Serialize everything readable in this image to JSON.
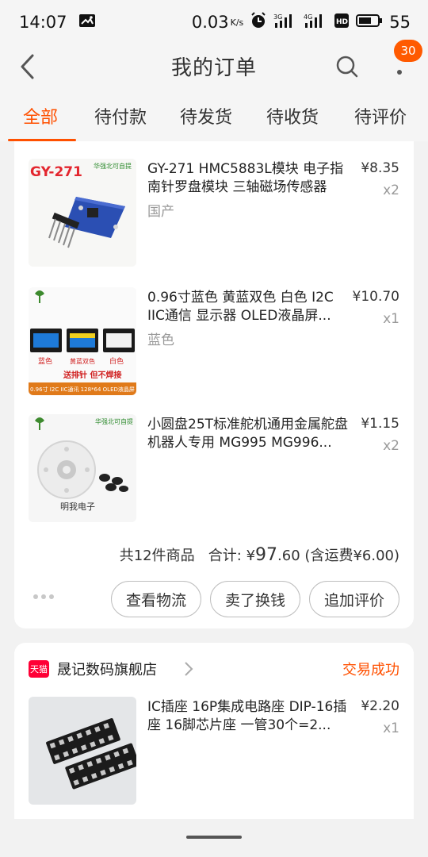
{
  "status_bar": {
    "time": "14:07",
    "net_speed": "0.03",
    "net_unit": "K/s",
    "signal_3g": "3G",
    "signal_4g": "4G",
    "hd": "HD",
    "battery": "55"
  },
  "header": {
    "title": "我的订单",
    "badge_count": "30"
  },
  "tabs": [
    {
      "label": "全部",
      "active": true
    },
    {
      "label": "待付款"
    },
    {
      "label": "待发货"
    },
    {
      "label": "待收货"
    },
    {
      "label": "待评价"
    }
  ],
  "order1": {
    "items": [
      {
        "title": "GY-271 HMC5883L模块 电子指南针罗盘模块 三轴磁场传感器",
        "spec": "国产",
        "price": "¥8.35",
        "qty": "x2",
        "thumb_text": "GY-271",
        "thumb_brand": "华强北可自提"
      },
      {
        "title": "0.96寸蓝色 黄蓝双色 白色 I2C IIC通信 显示器 OLED液晶屏...",
        "spec": "蓝色",
        "price": "¥10.70",
        "qty": "x1",
        "thumb_labels": [
          "蓝色",
          "黄蓝双色",
          "白色"
        ],
        "thumb_tag": "送排针 但不焊接",
        "thumb_footer": "0.96寸 I2C IIC通讯 128*64 OLED液晶屏"
      },
      {
        "title": "小圆盘25T标准舵机通用金属舵盘 机器人专用 MG995 MG996...",
        "spec": "",
        "price": "¥1.15",
        "qty": "x2",
        "thumb_brand": "华强北可自提",
        "thumb_text": "明我电子"
      }
    ],
    "summary": {
      "count_text": "共12件商品",
      "total_label": "合计:",
      "currency": "¥",
      "total_int": "97",
      "total_dec": ".60",
      "shipping": "(含运费¥6.00)"
    },
    "buttons": {
      "logistics": "查看物流",
      "sell": "卖了换钱",
      "review": "追加评价"
    }
  },
  "order2": {
    "shop_badge": "天猫",
    "shop_name": "晟记数码旗舰店",
    "status": "交易成功",
    "items": [
      {
        "title": "IC插座 16P集成电路座 DIP-16插座 16脚芯片座 一管30个=2...",
        "price": "¥2.20",
        "qty": "x1"
      }
    ]
  },
  "colors": {
    "accent": "#ff5000",
    "badge": "#ff5a00",
    "tmall": "#ff0036"
  }
}
